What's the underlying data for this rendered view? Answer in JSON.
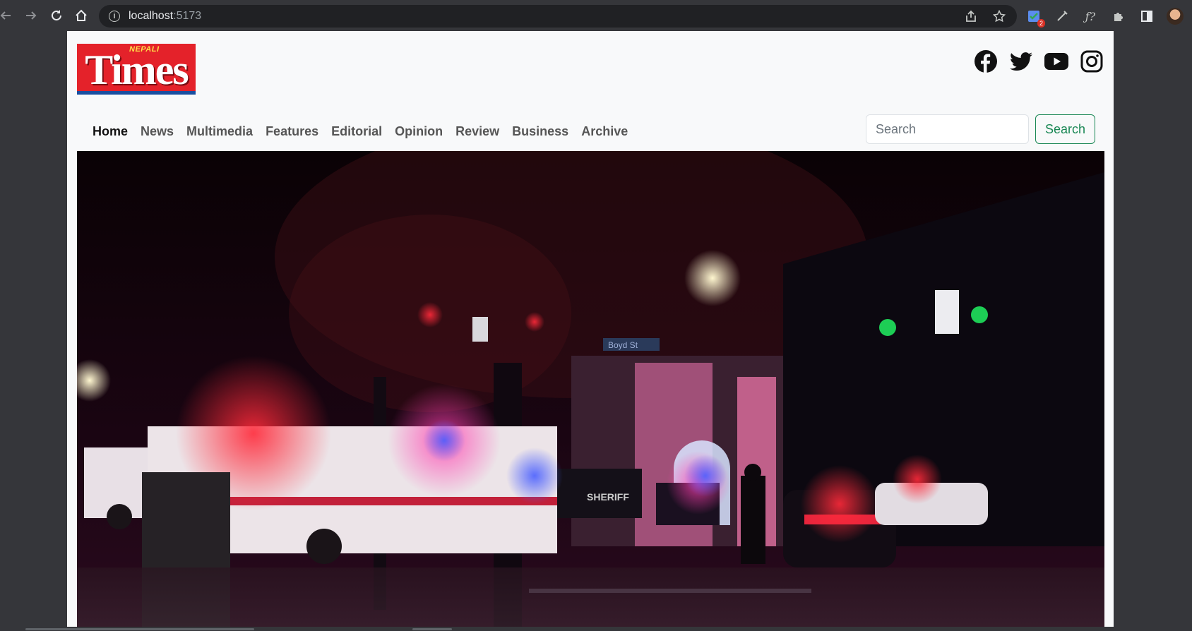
{
  "browser": {
    "url_host": "localhost",
    "url_port": ":5173",
    "extension_badge": "2"
  },
  "site": {
    "logo_small": "NEPALI",
    "logo_main": "Times"
  },
  "nav": {
    "items": [
      "Home",
      "News",
      "Multimedia",
      "Features",
      "Editorial",
      "Opinion",
      "Review",
      "Business",
      "Archive"
    ],
    "active": "Home"
  },
  "search": {
    "placeholder": "Search",
    "button_label": "Search"
  },
  "social": [
    "facebook-icon",
    "twitter-icon",
    "youtube-icon",
    "instagram-icon"
  ],
  "hero": {
    "street_sign": "Boyd St",
    "vehicle_label": "SHERIFF"
  },
  "colors": {
    "logo_red": "#e4222a",
    "logo_blue": "#1a4fa0",
    "search_green": "#198754",
    "page_bg": "#f8f9fa"
  }
}
